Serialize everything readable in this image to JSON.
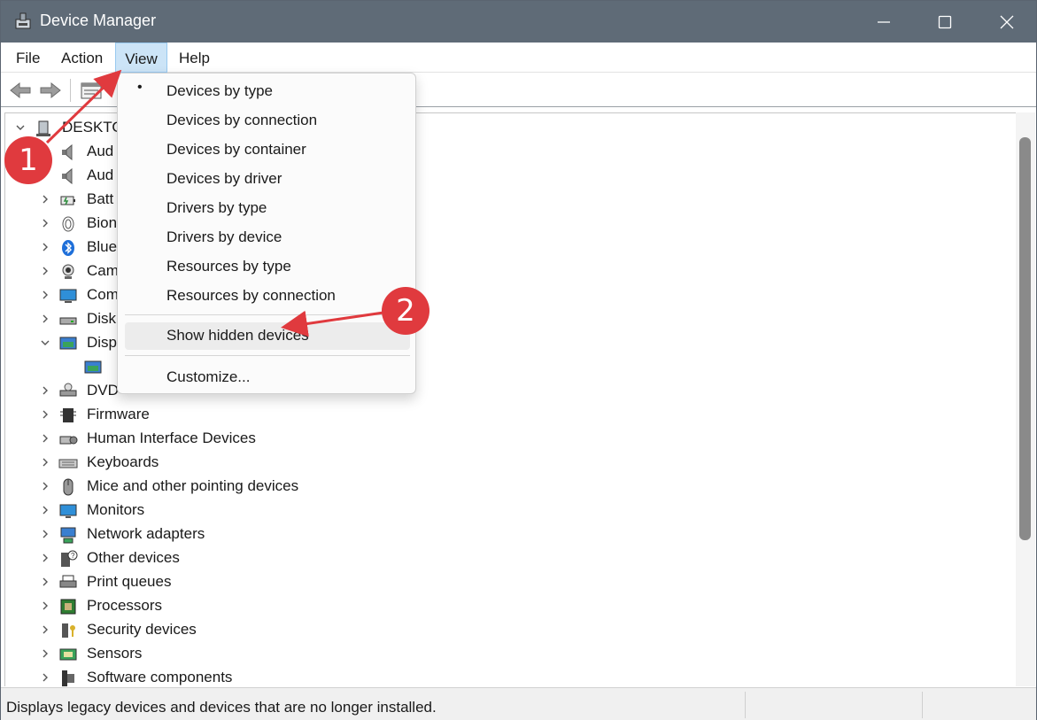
{
  "window": {
    "title": "Device Manager"
  },
  "menubar": {
    "file": "File",
    "action": "Action",
    "view": "View",
    "help": "Help"
  },
  "tree": {
    "root": "DESKTOP",
    "items": [
      {
        "label": "Aud",
        "icon": "speaker-icon"
      },
      {
        "label": "Aud",
        "icon": "speaker-icon"
      },
      {
        "label": "Batt",
        "icon": "battery-icon"
      },
      {
        "label": "Bion",
        "icon": "fingerprint-icon"
      },
      {
        "label": "Blue",
        "icon": "bluetooth-icon"
      },
      {
        "label": "Cam",
        "icon": "camera-icon"
      },
      {
        "label": "Com",
        "icon": "computer-icon"
      },
      {
        "label": "Disk",
        "icon": "disk-drive-icon"
      },
      {
        "label": "Disp",
        "icon": "display-adapter-icon"
      },
      {
        "label": "",
        "icon": "display-adapter-icon"
      },
      {
        "label": "DVD",
        "icon": "dvd-drive-icon"
      },
      {
        "label": "Firmware",
        "icon": "chip-icon"
      },
      {
        "label": "Human Interface Devices",
        "icon": "hid-icon"
      },
      {
        "label": "Keyboards",
        "icon": "keyboard-icon"
      },
      {
        "label": "Mice and other pointing devices",
        "icon": "mouse-icon"
      },
      {
        "label": "Monitors",
        "icon": "monitor-icon"
      },
      {
        "label": "Network adapters",
        "icon": "network-icon"
      },
      {
        "label": "Other devices",
        "icon": "unknown-device-icon"
      },
      {
        "label": "Print queues",
        "icon": "printer-icon"
      },
      {
        "label": "Processors",
        "icon": "processor-icon"
      },
      {
        "label": "Security devices",
        "icon": "security-key-icon"
      },
      {
        "label": "Sensors",
        "icon": "sensor-icon"
      },
      {
        "label": "Software components",
        "icon": "software-component-icon"
      }
    ]
  },
  "view_menu": {
    "items": [
      {
        "label": "Devices by type",
        "checked": true
      },
      {
        "label": "Devices by connection"
      },
      {
        "label": "Devices by container"
      },
      {
        "label": "Devices by driver"
      },
      {
        "label": "Drivers by type"
      },
      {
        "label": "Drivers by device"
      },
      {
        "label": "Resources by type"
      },
      {
        "label": "Resources by connection"
      }
    ],
    "show_hidden": "Show hidden devices",
    "customize": "Customize...",
    "bullet": "•"
  },
  "annotations": {
    "step1": "1",
    "step2": "2"
  },
  "statusbar": {
    "text": "Displays legacy devices and devices that are no longer installed."
  },
  "colors": {
    "titlebar": "#5f6b77",
    "menu_highlight": "#cce4f7",
    "annotation_red": "#e03a3e"
  }
}
